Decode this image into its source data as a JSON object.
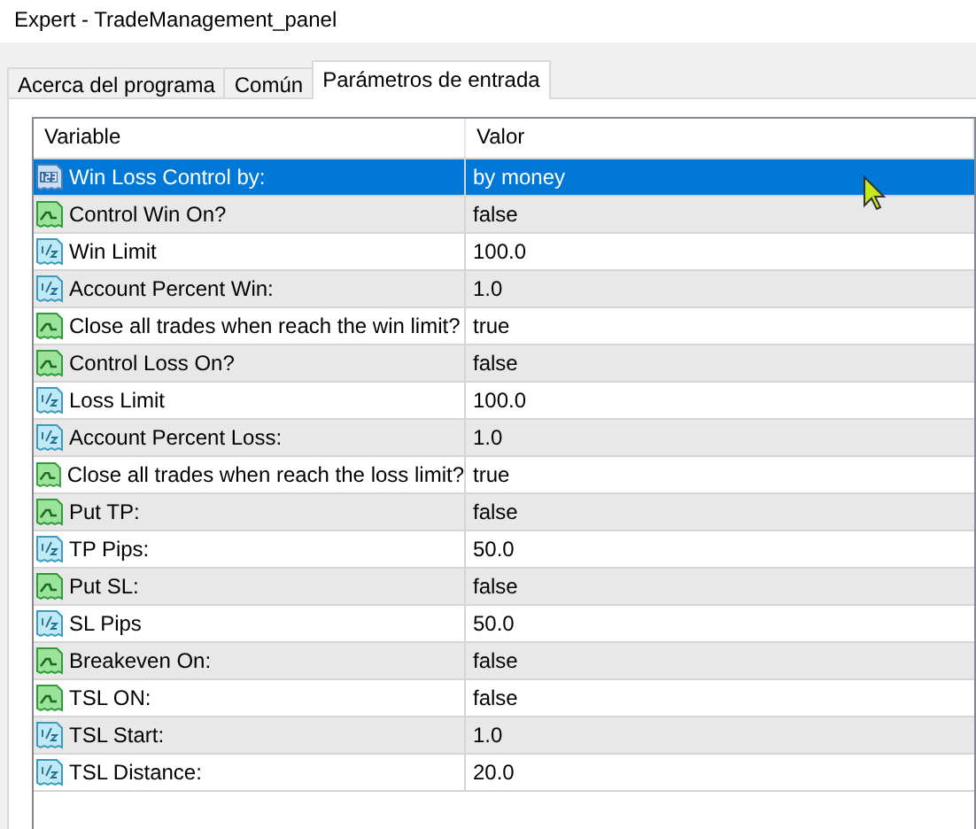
{
  "window": {
    "title": "Expert - TradeManagement_panel"
  },
  "tabs": [
    {
      "label": "Acerca del programa",
      "selected": false
    },
    {
      "label": "Común",
      "selected": false
    },
    {
      "label": "Parámetros de entrada",
      "selected": true
    }
  ],
  "table": {
    "columns": [
      "Variable",
      "Valor"
    ],
    "rows": [
      {
        "kind": "enum",
        "variable": "Win Loss Control by:",
        "value": "by money",
        "selected": true
      },
      {
        "kind": "bool",
        "variable": "Control Win On?",
        "value": "false",
        "selected": false
      },
      {
        "kind": "double",
        "variable": "Win Limit",
        "value": "100.0",
        "selected": false
      },
      {
        "kind": "double",
        "variable": "Account Percent Win:",
        "value": "1.0",
        "selected": false
      },
      {
        "kind": "bool",
        "variable": "Close all trades when reach the win limit?",
        "value": "true",
        "selected": false
      },
      {
        "kind": "bool",
        "variable": "Control Loss On?",
        "value": "false",
        "selected": false
      },
      {
        "kind": "double",
        "variable": "Loss Limit",
        "value": "100.0",
        "selected": false
      },
      {
        "kind": "double",
        "variable": "Account Percent Loss:",
        "value": "1.0",
        "selected": false
      },
      {
        "kind": "bool",
        "variable": "Close all trades when reach the loss limit?",
        "value": "true",
        "selected": false
      },
      {
        "kind": "bool",
        "variable": "Put TP:",
        "value": "false",
        "selected": false
      },
      {
        "kind": "double",
        "variable": "TP Pips:",
        "value": "50.0",
        "selected": false
      },
      {
        "kind": "bool",
        "variable": "Put SL:",
        "value": "false",
        "selected": false
      },
      {
        "kind": "double",
        "variable": "SL Pips",
        "value": "50.0",
        "selected": false
      },
      {
        "kind": "bool",
        "variable": "Breakeven On:",
        "value": "false",
        "selected": false
      },
      {
        "kind": "bool",
        "variable": "TSL ON:",
        "value": "false",
        "selected": false
      },
      {
        "kind": "double",
        "variable": "TSL Start:",
        "value": "1.0",
        "selected": false
      },
      {
        "kind": "double",
        "variable": "TSL Distance:",
        "value": "20.0",
        "selected": false
      }
    ]
  }
}
